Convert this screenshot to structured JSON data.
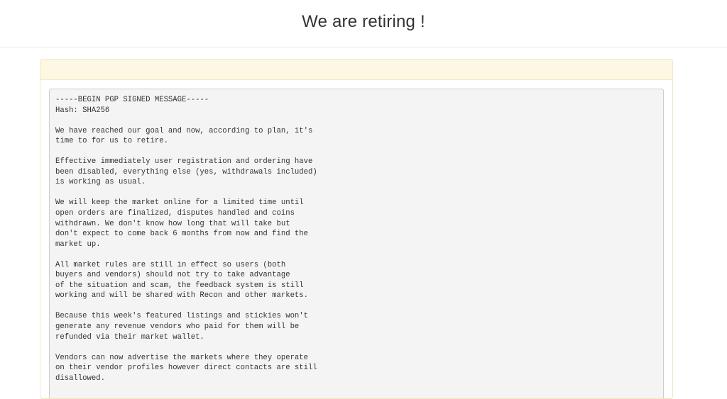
{
  "header": {
    "title": "We are retiring !"
  },
  "message": {
    "lines": [
      "-----BEGIN PGP SIGNED MESSAGE-----",
      "Hash: SHA256",
      "",
      "We have reached our goal and now, according to plan, it's",
      "time to for us to retire.",
      "",
      "Effective immediately user registration and ordering have",
      "been disabled, everything else (yes, withdrawals included)",
      "is working as usual.",
      "",
      "We will keep the market online for a limited time until",
      "open orders are finalized, disputes handled and coins",
      "withdrawn. We don't know how long that will take but",
      "don't expect to come back 6 months from now and find the",
      "market up.",
      "",
      "All market rules are still in effect so users (both",
      "buyers and vendors) should not try to take advantage",
      "of the situation and scam, the feedback system is still",
      "working and will be shared with Recon and other markets.",
      "",
      "Because this week's featured listings and stickies won't",
      "generate any revenue vendors who paid for them will be",
      "refunded via their market wallet.",
      "",
      "Vendors can now advertise the markets where they operate",
      "on their vendor profiles however direct contacts are still",
      "disallowed."
    ]
  }
}
